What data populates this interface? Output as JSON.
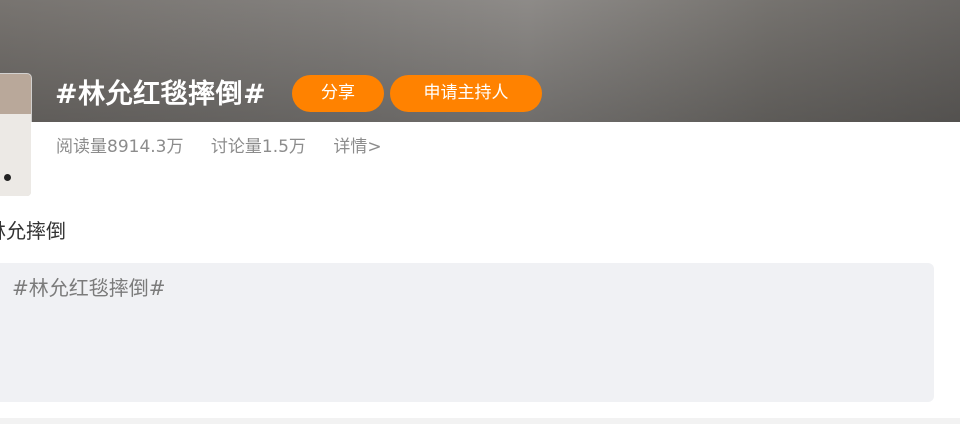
{
  "header": {
    "topic_title": "#林允红毯摔倒#",
    "share_button": "分享",
    "host_button": "申请主持人"
  },
  "stats": {
    "reads": "阅读量8914.3万",
    "discussions": "讨论量1.5万",
    "details_link": "详情>"
  },
  "post": {
    "lead_text": "林允摔倒",
    "composer_text": "#林允红毯摔倒#"
  },
  "colors": {
    "accent": "#ff8200",
    "muted_text": "#8c8c8c",
    "composer_bg": "#f0f1f4"
  }
}
